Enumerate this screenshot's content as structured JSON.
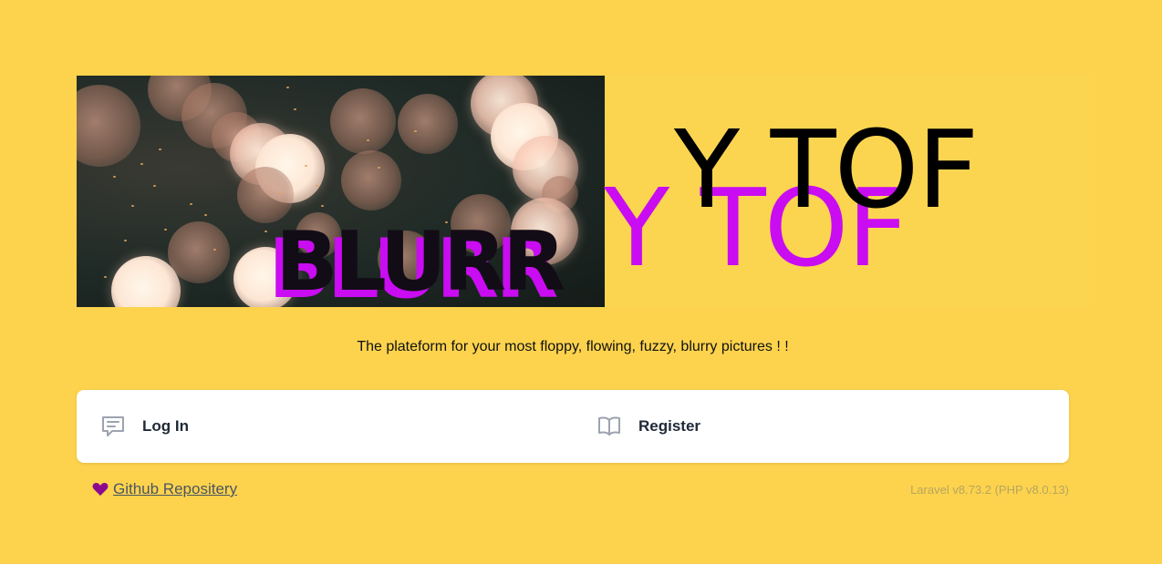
{
  "hero": {
    "word_left": "BLURR",
    "word_right_top": "Y TOF",
    "word_right_bottom": "Y TOF"
  },
  "tagline": "The plateform for your most floppy, flowing, fuzzy, blurry pictures ! !",
  "nav": {
    "login": {
      "label": "Log In",
      "icon": "chat-bubble-icon"
    },
    "register": {
      "label": "Register",
      "icon": "book-open-icon"
    }
  },
  "footer": {
    "github_label": "Github Repositery",
    "heart_icon": "heart-icon",
    "version": "Laravel v8.73.2 (PHP v8.0.13)"
  },
  "colors": {
    "background": "#fdd34d",
    "magenta": "#c90cf1",
    "heart": "#8b0a8e"
  }
}
